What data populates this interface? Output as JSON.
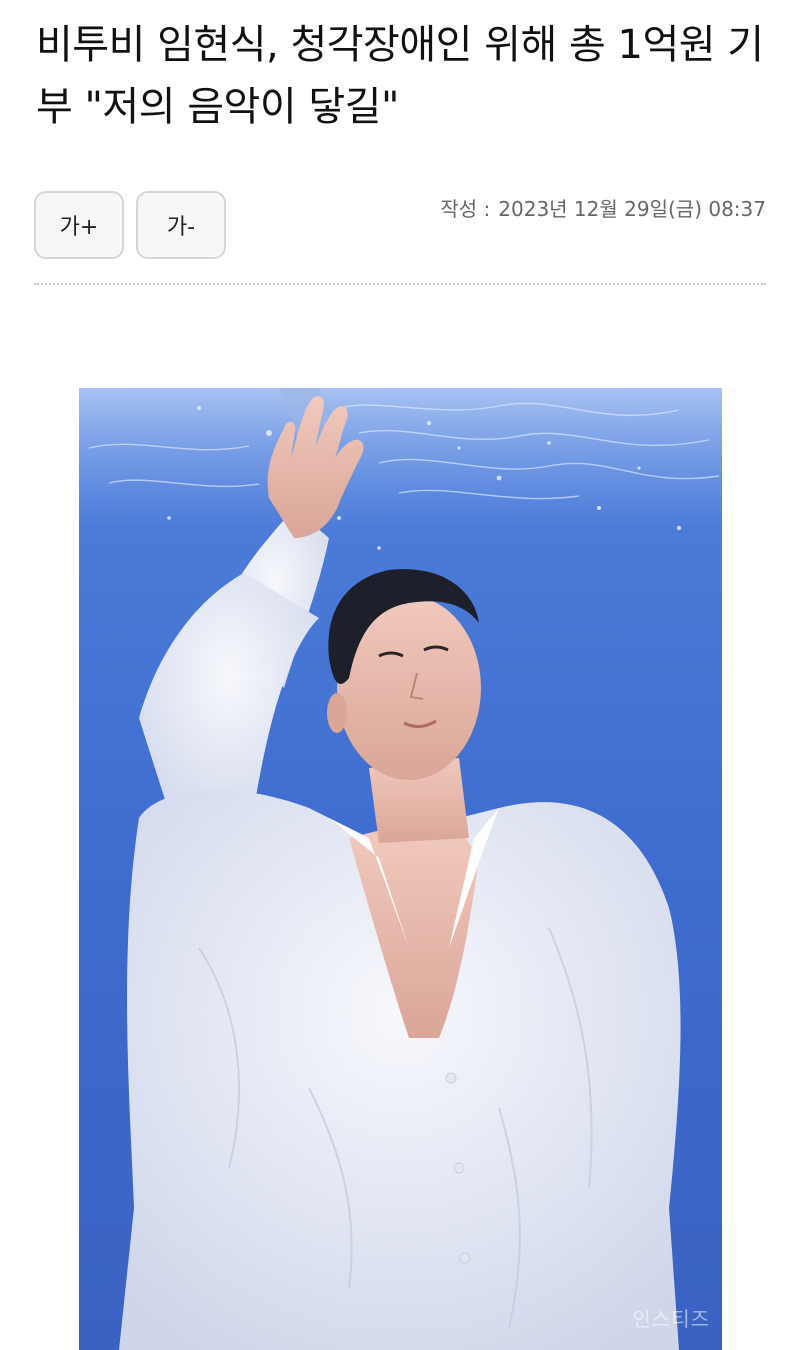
{
  "article": {
    "title": "비투비 임현식, 청각장애인 위해 총 1억원 기부 \"저의 음악이 닿길\"",
    "meta_label": "작성 :",
    "meta_date": "2023년 12월 29일(금) 08:37"
  },
  "font_controls": {
    "increase_label": "가+",
    "decrease_label": "가-"
  },
  "photo": {
    "watermark": "인스티즈"
  },
  "colors": {
    "water_blue": "#3f6fd0",
    "shirt_white": "#eef0f6"
  }
}
